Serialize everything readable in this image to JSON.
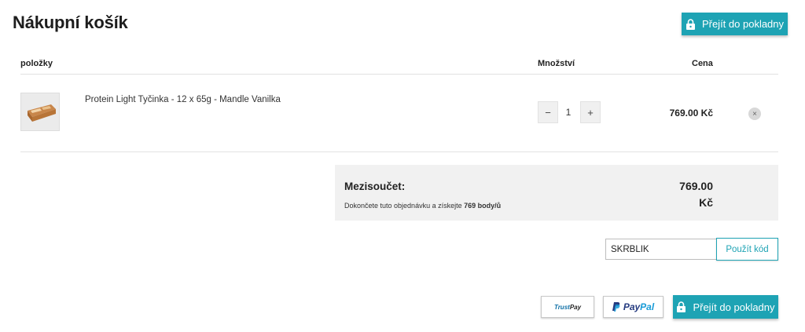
{
  "page": {
    "title": "Nákupní košík"
  },
  "checkout": {
    "label": "Přejít do pokladny",
    "icon": "lock-icon"
  },
  "table": {
    "col_items": "položky",
    "col_quantity": "Množství",
    "col_price": "Cena"
  },
  "item": {
    "name": "Protein Light Tyčinka - 12 x 65g - Mandle Vanilka",
    "quantity": "1",
    "minus": "−",
    "plus": "+",
    "price": "769.00 Kč",
    "remove": "×"
  },
  "summary": {
    "label": "Mezisoučet:",
    "note_prefix": "Dokončete tuto objednávku a získejte",
    "note_points": "769 body/ů",
    "amount": "769.00",
    "currency": "Kč"
  },
  "coupon": {
    "value": "SKRBLIK",
    "apply_label": "Použít kód"
  },
  "payments": {
    "trustpay_a": "Trust",
    "trustpay_b": "Pay",
    "paypal_a": "Pay",
    "paypal_b": "Pal"
  },
  "colors": {
    "accent": "#1ea3b4",
    "summary_bg": "#f1f1f1"
  }
}
